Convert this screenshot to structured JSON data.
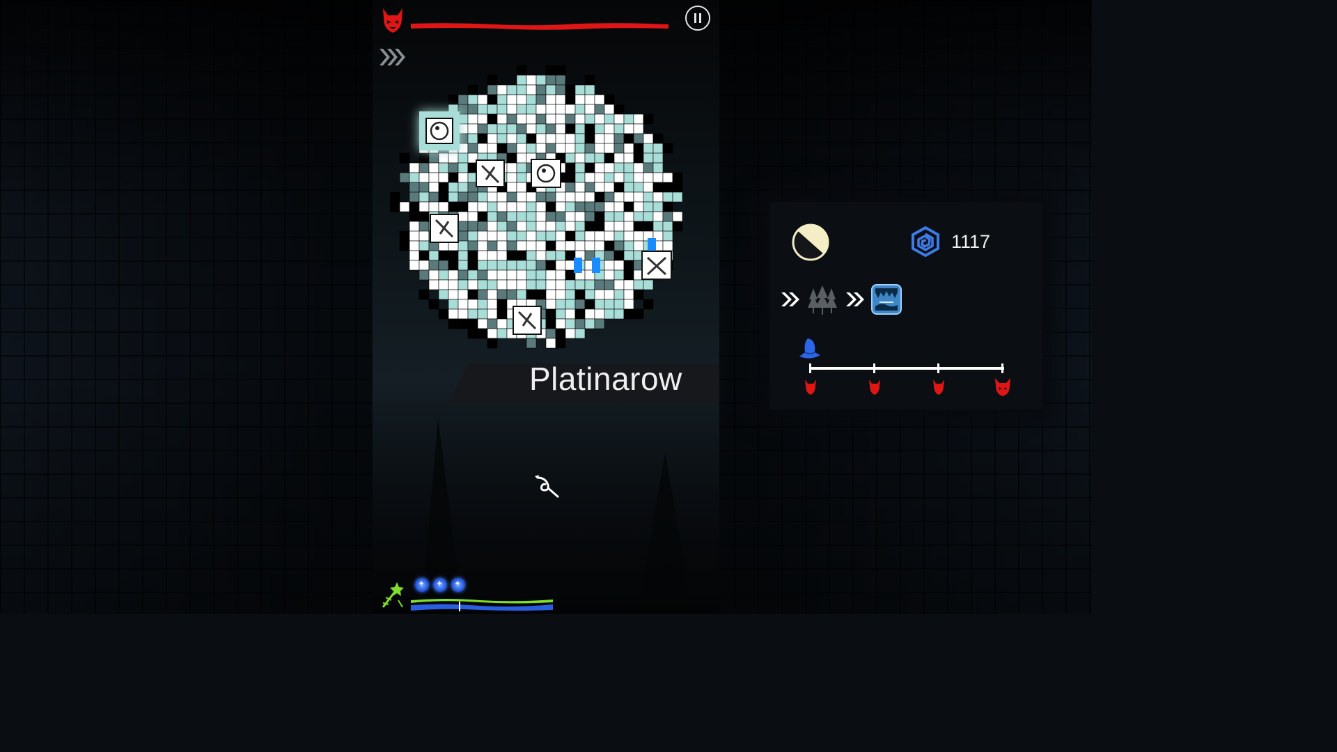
{
  "level": {
    "name": "Platinarow"
  },
  "currency": {
    "amount": "1117"
  },
  "colors": {
    "boss_red": "#e01616",
    "map_teal": "#a8ddd8",
    "map_white": "#ffffff",
    "mana_blue": "#2a5ee0",
    "mana_green": "#7ee02a",
    "accent_blue": "#3e86c6"
  },
  "icons": {
    "boss": "devil-head-icon",
    "pause": "pause-icon",
    "speed": "fast-forward-icon",
    "moon": "moon-phase-icon",
    "currency": "blue-spiral-icon",
    "route": [
      "fast-forward-icon",
      "forest-icon",
      "fast-forward-icon",
      "ice-cave-icon"
    ],
    "cursor": "spiral-cursor-icon",
    "wand": "magic-wand-icon",
    "player": "wizard-hat-icon",
    "map_nodes": [
      "orb-node-icon",
      "orb-node-icon",
      "broken-sword-node-icon",
      "broken-sword-node-icon",
      "broken-sword-node-icon",
      "crossed-weapons-node-icon"
    ]
  },
  "mana": {
    "orbs": 3
  },
  "wave_progress": {
    "checkpoints": 4,
    "player_position": 0
  }
}
